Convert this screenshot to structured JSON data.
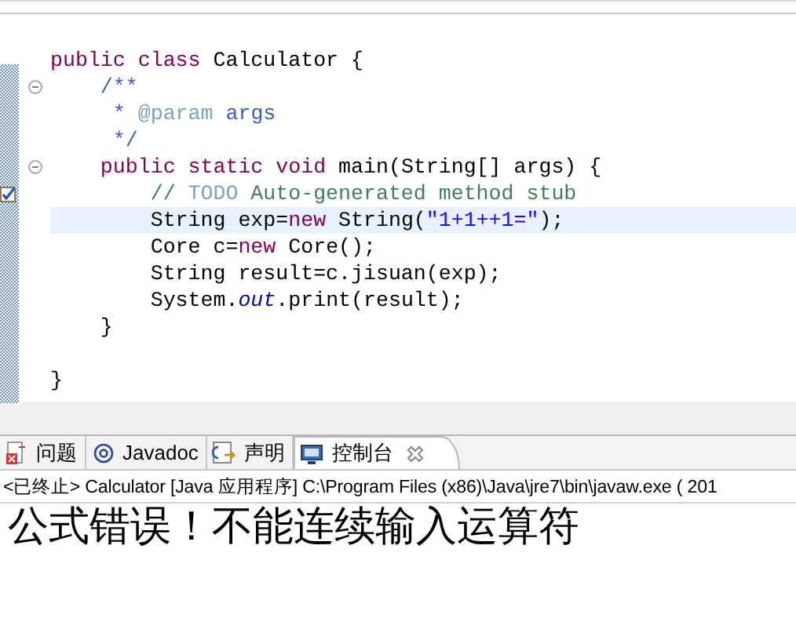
{
  "editor": {
    "lines": [
      {
        "kind": "code",
        "fold": false,
        "highlighted": false,
        "task_marker": false,
        "tokens": [
          {
            "text": "public class",
            "kind": "keyword"
          },
          {
            "text": " Calculator {",
            "kind": "plain"
          }
        ]
      },
      {
        "kind": "code",
        "fold": true,
        "highlighted": false,
        "task_marker": false,
        "tokens": [
          {
            "text": "    /**",
            "kind": "javadoc"
          }
        ]
      },
      {
        "kind": "code",
        "fold": false,
        "highlighted": false,
        "task_marker": false,
        "tokens": [
          {
            "text": "     * ",
            "kind": "javadoc"
          },
          {
            "text": "@param",
            "kind": "javadoc-tag"
          },
          {
            "text": " args",
            "kind": "javadoc"
          }
        ]
      },
      {
        "kind": "code",
        "fold": false,
        "highlighted": false,
        "task_marker": false,
        "tokens": [
          {
            "text": "     */",
            "kind": "javadoc"
          }
        ]
      },
      {
        "kind": "code",
        "fold": true,
        "highlighted": false,
        "task_marker": false,
        "tokens": [
          {
            "text": "    public static void",
            "kind": "keyword"
          },
          {
            "text": " main(String[] args) {",
            "kind": "plain"
          }
        ]
      },
      {
        "kind": "code",
        "fold": false,
        "highlighted": false,
        "task_marker": true,
        "tokens": [
          {
            "text": "        // ",
            "kind": "comment"
          },
          {
            "text": "TODO",
            "kind": "todo"
          },
          {
            "text": " Auto-generated method stub",
            "kind": "comment"
          }
        ]
      },
      {
        "kind": "code",
        "fold": false,
        "highlighted": true,
        "task_marker": false,
        "tokens": [
          {
            "text": "        String exp=",
            "kind": "plain"
          },
          {
            "text": "new",
            "kind": "keyword"
          },
          {
            "text": " String(",
            "kind": "plain"
          },
          {
            "text": "\"1+1++1=\"",
            "kind": "string"
          },
          {
            "text": ");",
            "kind": "plain"
          }
        ]
      },
      {
        "kind": "code",
        "fold": false,
        "highlighted": false,
        "task_marker": false,
        "tokens": [
          {
            "text": "        Core c=",
            "kind": "plain"
          },
          {
            "text": "new",
            "kind": "keyword"
          },
          {
            "text": " Core();",
            "kind": "plain"
          }
        ]
      },
      {
        "kind": "code",
        "fold": false,
        "highlighted": false,
        "task_marker": false,
        "tokens": [
          {
            "text": "        String result=c.jisuan(exp);",
            "kind": "plain"
          }
        ]
      },
      {
        "kind": "code",
        "fold": false,
        "highlighted": false,
        "task_marker": false,
        "tokens": [
          {
            "text": "        System.",
            "kind": "plain"
          },
          {
            "text": "out",
            "kind": "static-field"
          },
          {
            "text": ".print(result);",
            "kind": "plain"
          }
        ]
      },
      {
        "kind": "code",
        "fold": false,
        "highlighted": false,
        "task_marker": false,
        "tokens": [
          {
            "text": "    }",
            "kind": "plain"
          }
        ]
      },
      {
        "kind": "blank"
      },
      {
        "kind": "code",
        "fold": false,
        "highlighted": false,
        "task_marker": false,
        "tokens": [
          {
            "text": "}",
            "kind": "plain"
          }
        ]
      }
    ]
  },
  "console": {
    "tabs": [
      {
        "label": "问题",
        "selected": false,
        "closable": false
      },
      {
        "label": "Javadoc",
        "selected": false,
        "closable": false
      },
      {
        "label": "声明",
        "selected": false,
        "closable": false
      },
      {
        "label": "控制台",
        "selected": true,
        "closable": true
      }
    ],
    "header": "<已终止> Calculator [Java 应用程序] C:\\Program Files (x86)\\Java\\jre7\\bin\\javaw.exe ( 201",
    "output": "公式错误！不能连续输入运算符"
  }
}
